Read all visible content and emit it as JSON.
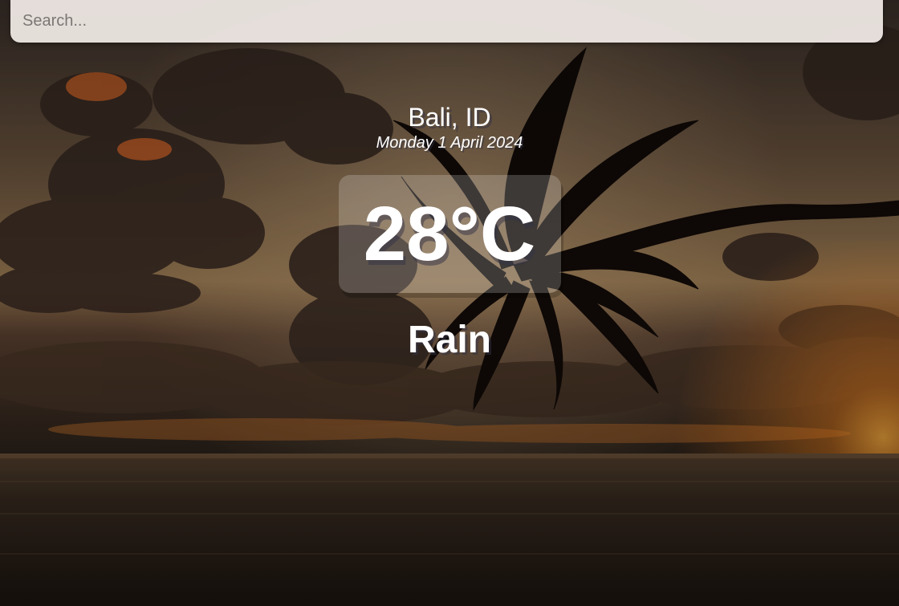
{
  "search": {
    "placeholder": "Search...",
    "value": ""
  },
  "location": {
    "city": "Bali, ID",
    "date": "Monday 1 April 2024"
  },
  "weather": {
    "temperature": "28°C",
    "condition": "Rain"
  },
  "background": {
    "scene": "tropical sunset beach with palm tree",
    "colors": {
      "sky_top": "#4a3a30",
      "sky_glow": "#c98a4a",
      "sun": "#ff9a2a",
      "water": "#3a2e24",
      "silhouette": "#120c08"
    }
  }
}
